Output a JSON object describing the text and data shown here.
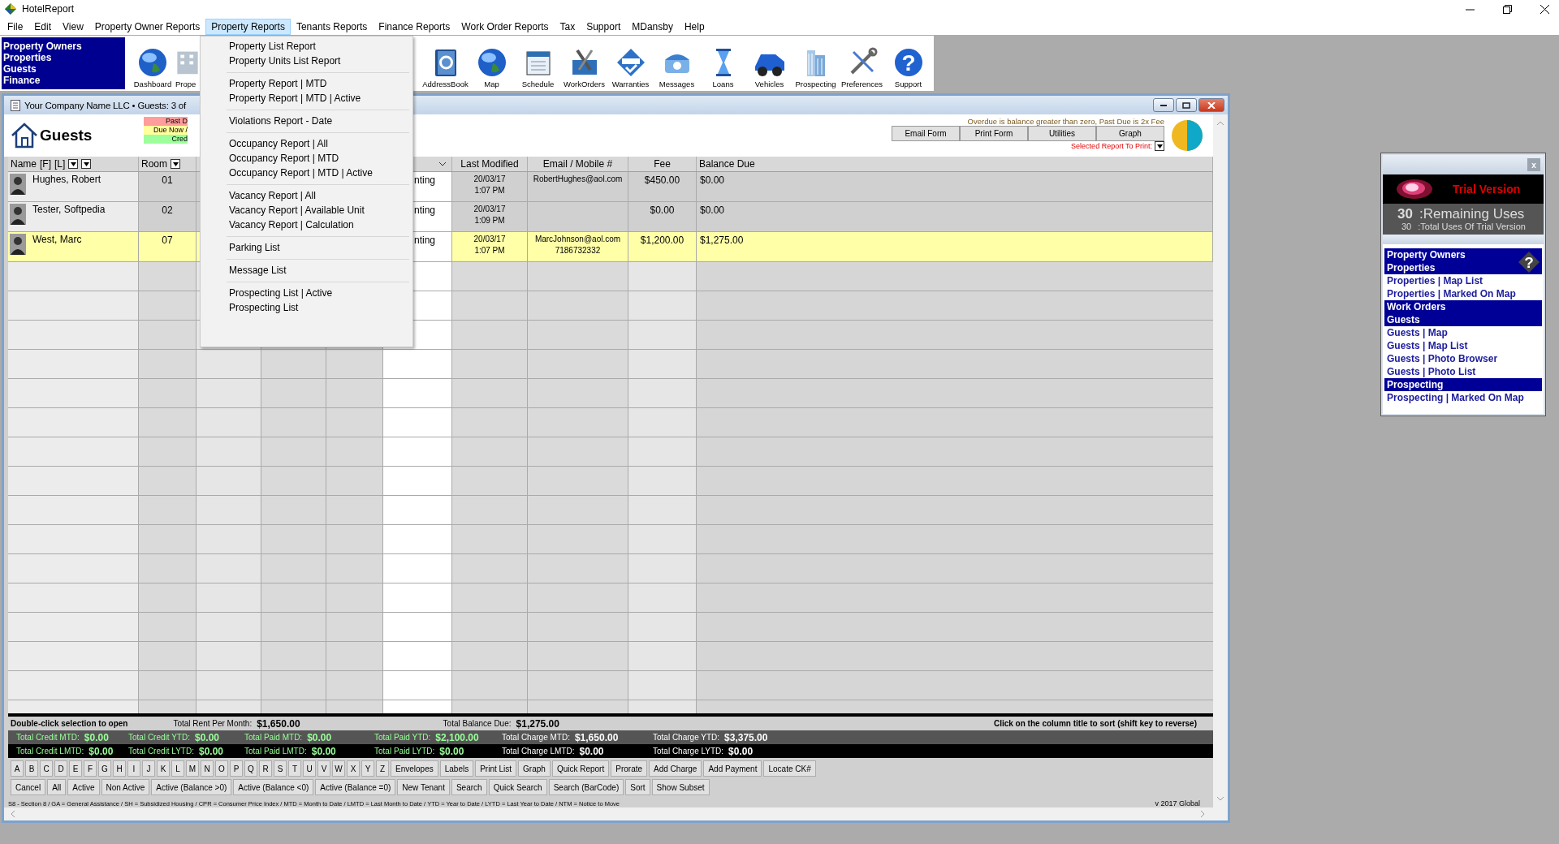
{
  "window": {
    "title": "HotelReport"
  },
  "menu_bar": [
    {
      "label": "File",
      "selected": false
    },
    {
      "label": "Edit",
      "selected": false
    },
    {
      "label": "View",
      "selected": false
    },
    {
      "label": "Property Owner Reports",
      "selected": false
    },
    {
      "label": "Property Reports",
      "selected": true
    },
    {
      "label": "Tenants Reports",
      "selected": false
    },
    {
      "label": "Finance Reports",
      "selected": false
    },
    {
      "label": "Work Order Reports",
      "selected": false
    },
    {
      "label": "Tax",
      "selected": false
    },
    {
      "label": "Support",
      "selected": false
    },
    {
      "label": "MDansby",
      "selected": false
    },
    {
      "label": "Help",
      "selected": false
    }
  ],
  "dropdown": {
    "groups": [
      [
        "Property List Report",
        "Property Units List Report"
      ],
      [
        "Property Report | MTD",
        "Property Report | MTD | Active"
      ],
      [
        "Violations Report - Date"
      ],
      [
        "Occupancy Report | All",
        "Occupancy Report | MTD",
        "Occupancy Report | MTD | Active"
      ],
      [
        "Vacancy Report | All",
        "Vacancy Report | Available Unit",
        "Vacancy Report | Calculation"
      ],
      [
        "Parking List"
      ],
      [
        "Message List"
      ],
      [
        "Prospecting List | Active",
        "Prospecting List"
      ]
    ]
  },
  "toolbar": {
    "quick_links": [
      "Property Owners",
      "Properties",
      "Guests",
      "Finance"
    ],
    "tools_left": [
      {
        "label": "Dashboard",
        "kind": "globe"
      },
      {
        "label": "Prope",
        "kind": "building"
      }
    ],
    "tools_right": [
      {
        "label": "AddressBook",
        "kind": "book"
      },
      {
        "label": "Map",
        "kind": "globe"
      },
      {
        "label": "Schedule",
        "kind": "notebook"
      },
      {
        "label": "WorkOrders",
        "kind": "toolbox"
      },
      {
        "label": "Warranties",
        "kind": "badge"
      },
      {
        "label": "Messages",
        "kind": "phone"
      },
      {
        "label": "Loans",
        "kind": "hourglass"
      },
      {
        "label": "Vehicles",
        "kind": "car"
      },
      {
        "label": "Prospecting",
        "kind": "tower"
      },
      {
        "label": "Preferences",
        "kind": "tools"
      },
      {
        "label": "Support",
        "kind": "help",
        "glyph": "?"
      }
    ]
  },
  "guests_window": {
    "title": "Your Company Name LLC • Guests: 3 of",
    "heading": "Guests",
    "legend": [
      {
        "label": "Past D",
        "color": "#ff9c9c"
      },
      {
        "label": "Due Now /",
        "color": "#ffff9c"
      },
      {
        "label": "Cred",
        "color": "#9cff9c"
      }
    ],
    "note": "Overdue is balance greater than zero, Past Due is 2x Fee",
    "buttons": [
      "Email Form",
      "Print Form",
      "Utilities",
      "Graph"
    ],
    "report_select_label": "Selected Report To Print:",
    "table": {
      "name_header": "Name",
      "name_filters": [
        "[F]",
        "[L]"
      ],
      "columns": [
        "Room",
        "Last Modified",
        "Email / Mobile #",
        "Fee",
        "Balance Due"
      ],
      "rows": [
        {
          "name": "Hughes, Robert",
          "room": "01",
          "column_6": "nting",
          "date": "20/03/17",
          "time": "1:07 PM",
          "email": "RobertHughes@aol.com",
          "fee": "$450.00",
          "balance": "$0.00",
          "selected": false
        },
        {
          "name": "Tester, Softpedia",
          "room": "02",
          "column_6": "nting",
          "date": "20/03/17",
          "time": "1:09 PM",
          "fee": "$0.00",
          "balance": "$0.00",
          "selected": false
        },
        {
          "name": "West, Marc",
          "room": "07",
          "column_6": "nting",
          "date": "20/03/17",
          "time": "1:07 PM",
          "email": "MarcJohnson@aol.com",
          "mobile": "7186732332",
          "fee": "$1,200.00",
          "balance": "$1,275.00",
          "selected": true
        }
      ]
    },
    "summary": {
      "hint": "Double-click selection to open",
      "rent_label": "Total Rent Per Month:",
      "rent": "$1,650.00",
      "balance_label": "Total Balance Due:",
      "balance": "$1,275.00",
      "sort_hint": "Click on the column title to sort (shift key to reverse)"
    },
    "totals": [
      [
        {
          "label": "Total Credit MTD:",
          "value": "$0.00",
          "kind": "credit"
        },
        {
          "label": "Total Credit YTD:",
          "value": "$0.00",
          "kind": "credit"
        },
        {
          "label": "Total Paid MTD:",
          "value": "$0.00",
          "kind": "paid"
        },
        {
          "label": "Total Paid YTD:",
          "value": "$2,100.00",
          "kind": "paid"
        },
        {
          "label": "Total Charge MTD:",
          "value": "$1,650.00",
          "kind": "charge"
        },
        {
          "label": "Total Charge YTD:",
          "value": "$3,375.00",
          "kind": "charge"
        }
      ],
      [
        {
          "label": "Total Credit LMTD:",
          "value": "$0.00",
          "kind": "credit"
        },
        {
          "label": "Total Credit LYTD:",
          "value": "$0.00",
          "kind": "credit"
        },
        {
          "label": "Total Paid LMTD:",
          "value": "$0.00",
          "kind": "paid"
        },
        {
          "label": "Total Paid LYTD:",
          "value": "$0.00",
          "kind": "paid"
        },
        {
          "label": "Total Charge LMTD:",
          "value": "$0.00",
          "kind": "charge"
        },
        {
          "label": "Total Charge LYTD:",
          "value": "$0.00",
          "kind": "charge"
        }
      ]
    ],
    "letters": [
      "A",
      "B",
      "C",
      "D",
      "E",
      "F",
      "G",
      "H",
      "I",
      "J",
      "K",
      "L",
      "M",
      "N",
      "O",
      "P",
      "Q",
      "R",
      "S",
      "T",
      "U",
      "V",
      "W",
      "X",
      "Y",
      "Z"
    ],
    "buttons_row_1": [
      "Envelopes",
      "Labels",
      "Print List",
      "Graph",
      "Quick Report",
      "Prorate",
      "Add Charge",
      "Add Payment",
      "Locate CK#"
    ],
    "buttons_row_2": [
      "Cancel",
      "All",
      "Active",
      "Non Active",
      "Active (Balance >0)",
      "Active (Balance <0)",
      "Active (Balance =0)",
      "New Tenant",
      "Search",
      "Quick Search",
      "Search (BarCode)",
      "Sort",
      "Show Subset"
    ],
    "abbreviations": "S8 - Section 8  /  GA = General Assistance  /  SH = Subsidized Housing  /  CPR = Consumer Price Index  /  MTD = Month to Date  /  LMTD = Last Month to Date  /  YTD = Year to Date  /  LYTD = Last Year to Date  /  NTM = Notice to Move",
    "version": "v 2017 Global"
  },
  "side_panel": {
    "close": "x",
    "trial_title": "Trial Version",
    "remaining": "30",
    "remaining_label": ":Remaining Uses",
    "total": "30",
    "total_label": ":Total Uses Of Trial Version",
    "help_glyph": "?",
    "links": [
      {
        "label": "Property Owners",
        "kind": "header"
      },
      {
        "label": "Properties",
        "kind": "header"
      },
      {
        "label": "Properties | Map List",
        "kind": "link"
      },
      {
        "label": "Properties | Marked On Map",
        "kind": "link"
      },
      {
        "label": "Work Orders",
        "kind": "header"
      },
      {
        "label": "Guests",
        "kind": "header"
      },
      {
        "label": "Guests | Map",
        "kind": "link"
      },
      {
        "label": "Guests | Map List",
        "kind": "link"
      },
      {
        "label": "Guests | Photo Browser",
        "kind": "link"
      },
      {
        "label": "Guests | Photo List",
        "kind": "link"
      },
      {
        "label": "Prospecting",
        "kind": "header"
      },
      {
        "label": "Prospecting | Marked On Map",
        "kind": "link"
      }
    ]
  }
}
